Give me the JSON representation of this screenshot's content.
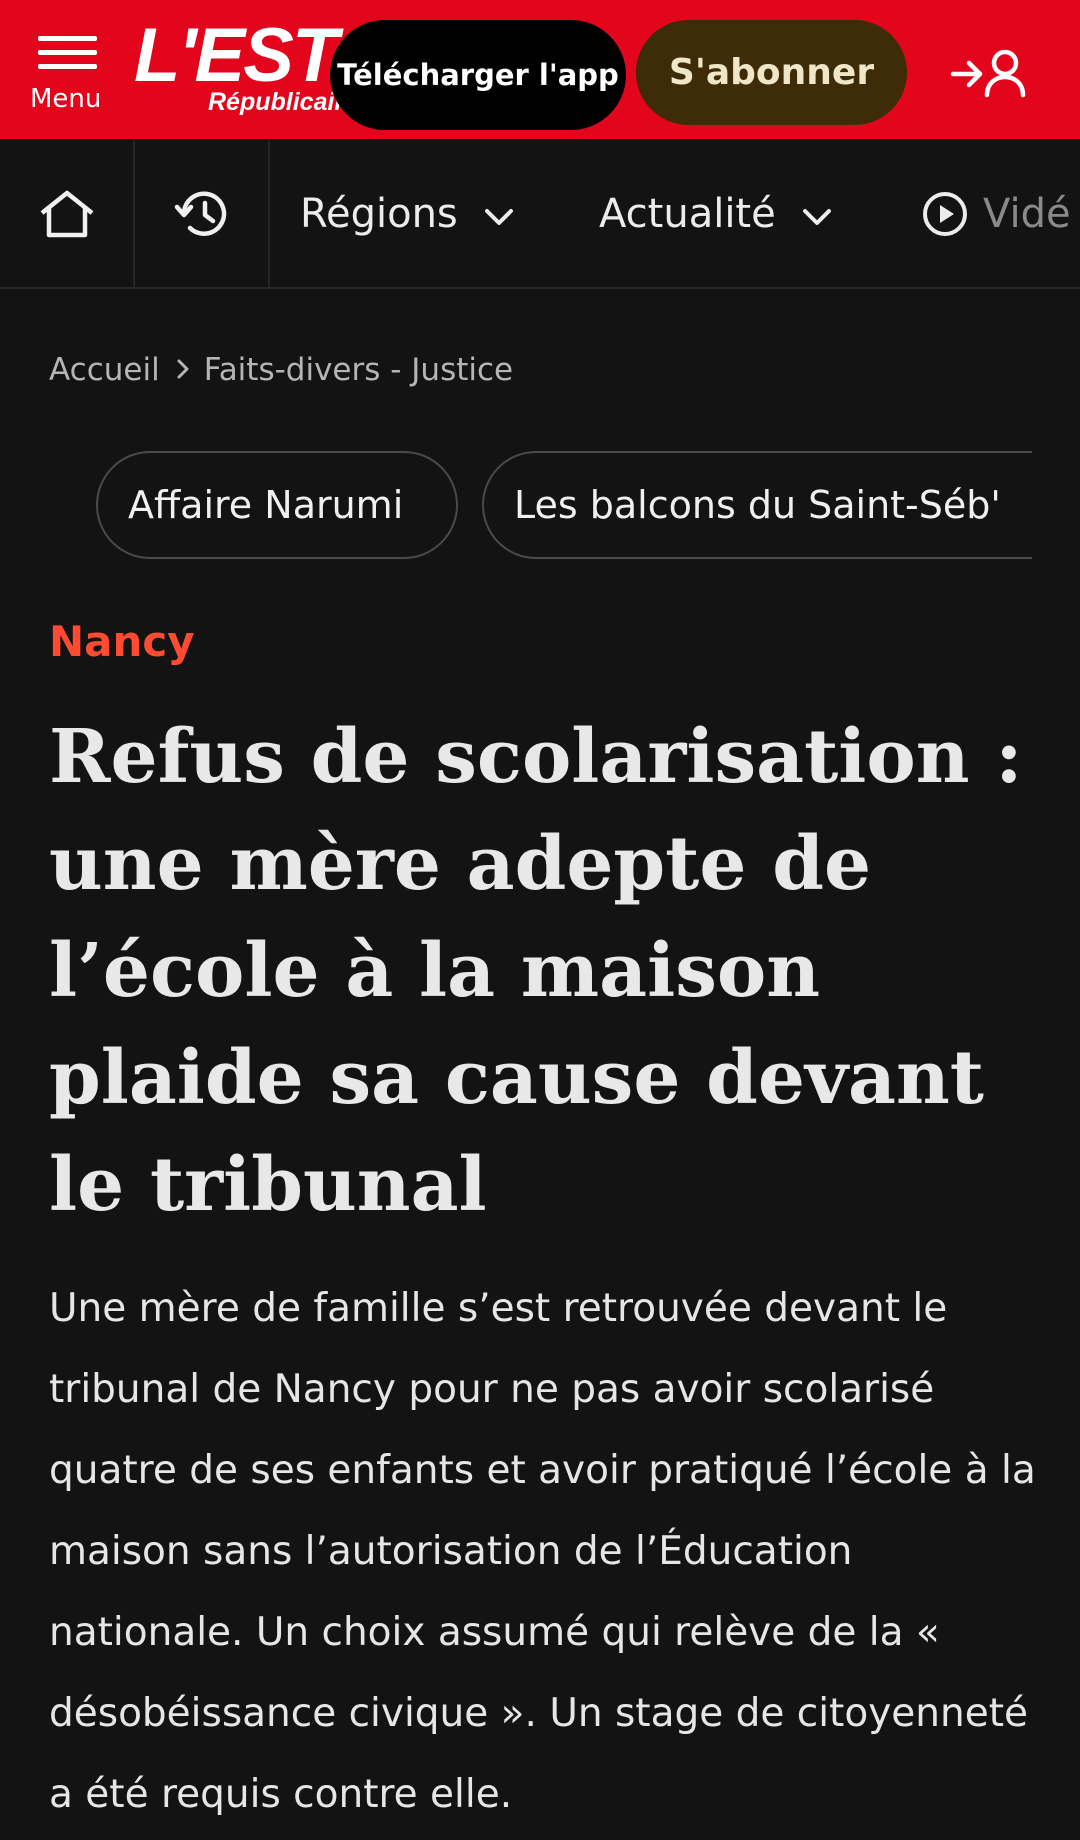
{
  "header": {
    "menu_label": "Menu",
    "logo_main": "L'EST",
    "logo_sub": "Républicain",
    "download_label": "Télécharger l'app",
    "subscribe_label": "S'abonner",
    "brand_color": "#e3051b"
  },
  "nav": {
    "items": [
      {
        "label": "Régions"
      },
      {
        "label": "Actualité"
      },
      {
        "label": "Vidé"
      }
    ]
  },
  "breadcrumb": {
    "home": "Accueil",
    "current": "Faits-divers - Justice"
  },
  "tags": [
    {
      "label": "Affaire Narumi"
    },
    {
      "label": "Les balcons du Saint-Séb'"
    }
  ],
  "article": {
    "section": "Nancy",
    "title": "Refus de scolarisation : une mère adepte de l’école à la maison plaide sa cause devant le tribunal",
    "lead": "Une mère de famille s’est retrouvée devant le tribunal de Nancy pour ne pas avoir scolarisé quatre de ses enfants et avoir pratiqué l’école à la maison sans l’autorisation de l’Éducation nationale. Un choix assumé qui relève de la « désobéissance civique ». Un stage de citoyenneté a été requis contre elle."
  },
  "icons": {
    "menu": "hamburger-icon",
    "login": "login-user-icon",
    "home": "home-icon",
    "history": "history-icon",
    "video": "play-circle-icon",
    "chevron": "chevron-down-icon",
    "breadcrumb_separator": "chevron-right-icon"
  },
  "colors": {
    "background": "#131313",
    "section": "#ff4b32",
    "subscribe_bg": "#3d2c07"
  }
}
